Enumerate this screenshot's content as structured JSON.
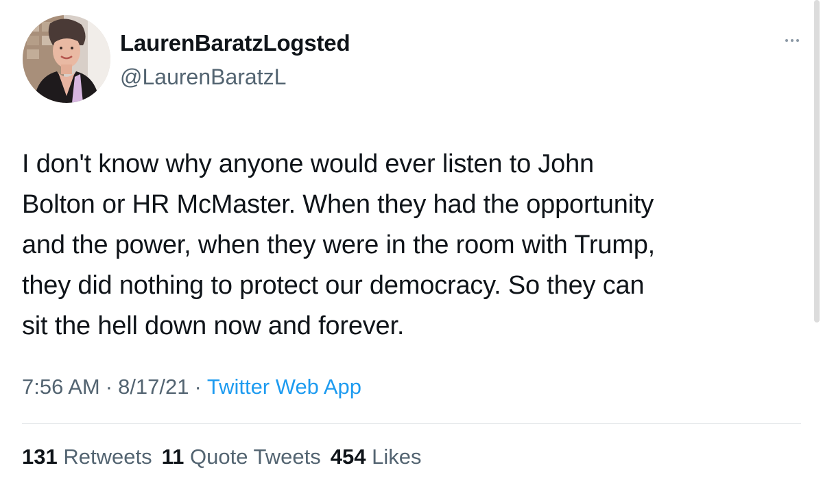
{
  "author": {
    "display_name": "LaurenBaratzLogsted",
    "handle": "@LaurenBaratzL",
    "avatar": "profile-photo"
  },
  "tweet": {
    "text": "I don't know why anyone would ever listen to John\nBolton or HR McMaster. When they had the opportunity\nand the power, when they were in the room with Trump,\nthey did nothing to protect our democracy. So they can\nsit the hell down now and forever.",
    "time": "7:56 AM",
    "date": "8/17/21",
    "separator": "·",
    "source": "Twitter Web App"
  },
  "stats": {
    "retweets_count": "131",
    "retweets_label": "Retweets",
    "quotes_count": "11",
    "quotes_label": "Quote Tweets",
    "likes_count": "454",
    "likes_label": "Likes"
  },
  "icons": {
    "more": "more-horizontal-icon"
  },
  "colors": {
    "text_primary": "#0f1419",
    "text_secondary": "#536471",
    "link": "#1d9bf0",
    "divider": "#e1e5e8"
  }
}
